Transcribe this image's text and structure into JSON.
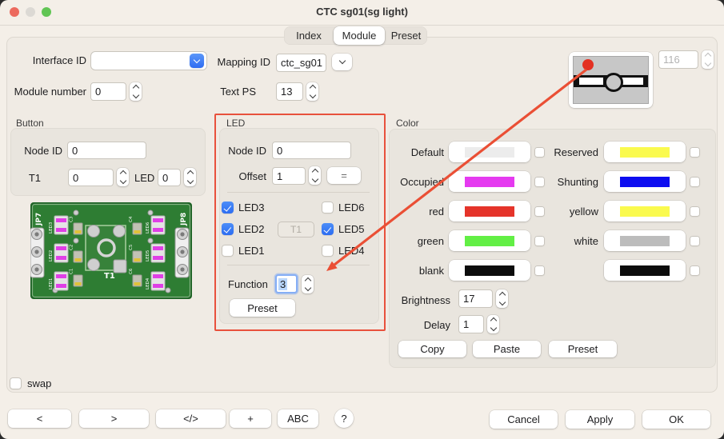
{
  "window": {
    "title": "CTC sg01(sg light)"
  },
  "tabs": {
    "index": "Index",
    "module": "Module",
    "preset": "Preset"
  },
  "top": {
    "interface_id_label": "Interface ID",
    "interface_id_value": "",
    "mapping_id_label": "Mapping ID",
    "mapping_id_value": "ctc_sg01",
    "module_number_label": "Module number",
    "module_number_value": "0",
    "text_ps_label": "Text PS",
    "text_ps_value": "13",
    "signal_number_value": "116"
  },
  "button_group": {
    "title": "Button",
    "node_id_label": "Node ID",
    "node_id_value": "0",
    "t1_label": "T1",
    "t1_value": "0",
    "led_label": "LED",
    "led_value": "0"
  },
  "pcb": {
    "jp7": "JP7",
    "jp8": "JP8",
    "t1": "T1",
    "led1": "LED1",
    "led2": "LED2",
    "led3": "LED3",
    "led4": "LED4",
    "led5": "LED5",
    "led6": "LED6",
    "c1": "C1",
    "c2": "C2",
    "c3": "C3",
    "c4": "C4",
    "c5": "C5",
    "c6": "C6"
  },
  "led_group": {
    "title": "LED",
    "node_id_label": "Node ID",
    "node_id_value": "0",
    "offset_label": "Offset",
    "offset_value": "1",
    "equals_button": "=",
    "checkboxes": [
      {
        "label": "LED3",
        "state": "checked"
      },
      {
        "label": "LED6",
        "state": "unchecked"
      },
      {
        "label": "LED2",
        "state": "checked"
      },
      {
        "label": "LED5",
        "state": "checked"
      },
      {
        "label": "LED1",
        "state": "unchecked"
      },
      {
        "label": "LED4",
        "state": "unchecked"
      }
    ],
    "t1_button": "T1",
    "function_label": "Function",
    "function_value": "3",
    "preset_button": "Preset"
  },
  "color_group": {
    "title": "Color",
    "rows_left": [
      {
        "label": "Default",
        "color": "#ececec"
      },
      {
        "label": "Occupied",
        "color": "#e53af0"
      },
      {
        "label": "red",
        "color": "#e5342a"
      },
      {
        "label": "green",
        "color": "#62ef45"
      },
      {
        "label": "blank",
        "color": "#0c0c0c"
      }
    ],
    "rows_right": [
      {
        "label": "Reserved",
        "color": "#fafa4e"
      },
      {
        "label": "Shunting",
        "color": "#0d0df0"
      },
      {
        "label": "yellow",
        "color": "#fafa4e"
      },
      {
        "label": "white",
        "color": "#bcbcbc"
      },
      {
        "label": "",
        "color": "#0c0c0c"
      }
    ],
    "brightness_label": "Brightness",
    "brightness_value": "17",
    "delay_label": "Delay",
    "delay_value": "1",
    "copy_button": "Copy",
    "paste_button": "Paste",
    "preset_button": "Preset"
  },
  "swap_label": "swap",
  "bottom_bar": {
    "prev": "<",
    "next": ">",
    "code": "</>",
    "plus": "+",
    "abc": "ABC",
    "help": "?",
    "cancel": "Cancel",
    "apply": "Apply",
    "ok": "OK"
  },
  "colors": {
    "accent_blue": "#2e6cf2",
    "arrow_red": "#ea4f35",
    "frame_red": "#e8513c",
    "traffic_red": "#ec6a5e",
    "traffic_gray": "#dcd9d4",
    "traffic_green": "#61c554"
  }
}
